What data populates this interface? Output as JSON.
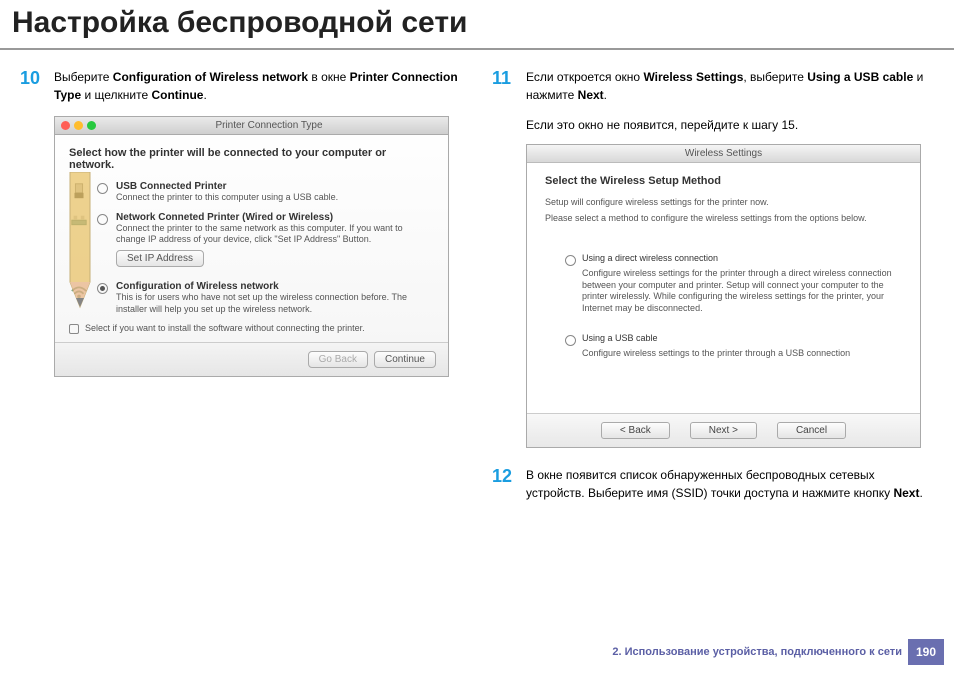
{
  "page_title": "Настройка беспроводной сети",
  "step10": {
    "num": "10",
    "text_a": "Выберите ",
    "text_b": "Configuration of Wireless network",
    "text_c": " в окне ",
    "text_d": "Printer Connection Type",
    "text_e": " и щелкните ",
    "text_f": "Continue",
    "text_g": "."
  },
  "mac_dialog": {
    "title": "Printer Connection Type",
    "heading": "Select how the printer will be connected to your computer or network.",
    "opt1_label": "USB Connected Printer",
    "opt1_desc": "Connect the printer to this computer using a USB cable.",
    "opt2_label": "Network Conneted Printer (Wired or Wireless)",
    "opt2_desc": "Connect the printer to the same network as this computer. If you want to change IP address of your device, click \"Set IP Address\" Button.",
    "setip": "Set IP Address",
    "opt3_label": "Configuration of Wireless network",
    "opt3_desc": "This is for users who have not set up the wireless connection before. The installer will help you set up the wireless network.",
    "checkbox": "Select if you want to install the software without connecting the printer.",
    "go_back": "Go Back",
    "continue": "Continue"
  },
  "step11": {
    "num": "11",
    "text_a": "Если откроется окно ",
    "text_b": "Wireless Settings",
    "text_c": ", выберите ",
    "text_d": "Using a USB cable",
    "text_e": " и нажмите ",
    "text_f": "Next",
    "text_g": ".",
    "sub": "Если это окно не появится, перейдите к шагу 15."
  },
  "win_dialog": {
    "title": "Wireless Settings",
    "heading": "Select the Wireless Setup Method",
    "sub1": "Setup will configure wireless settings for the printer now.",
    "sub2": "Please select a method to configure the wireless settings from the options below.",
    "opt1_label": "Using a direct wireless connection",
    "opt1_desc": "Configure wireless settings for the printer through a direct wireless connection between your computer and printer. Setup will connect your computer to the printer wirelessly. While configuring the wireless settings for the printer, your Internet may be disconnected.",
    "opt2_label": "Using a USB cable",
    "opt2_desc": "Configure wireless settings to the printer through a USB connection",
    "back": "< Back",
    "next": "Next >",
    "cancel": "Cancel"
  },
  "step12": {
    "num": "12",
    "text_a": "В окне появится список обнаруженных беспроводных сетевых устройств. Выберите имя (SSID) точки доступа и нажмите кнопку ",
    "text_b": "Next",
    "text_c": "."
  },
  "footer": {
    "chapter": "2.  Использование устройства, подключенного к сети",
    "page": "190"
  }
}
